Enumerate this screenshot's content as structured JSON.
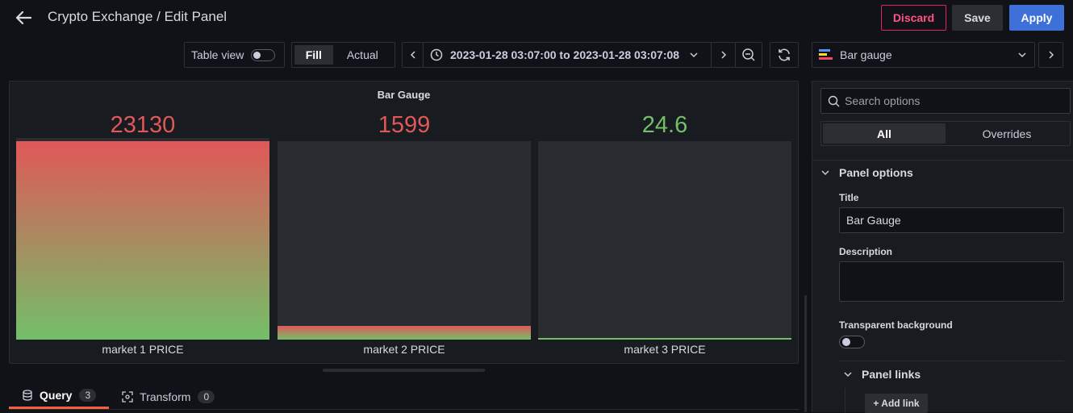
{
  "header": {
    "title": "Crypto Exchange / Edit Panel",
    "discard_label": "Discard",
    "save_label": "Save",
    "apply_label": "Apply"
  },
  "toolbar": {
    "table_view_label": "Table view",
    "fill_label": "Fill",
    "actual_label": "Actual",
    "time_range": "2023-01-28 03:07:00 to 2023-01-28 03:07:08",
    "visualization": "Bar gauge"
  },
  "panel": {
    "title": "Bar Gauge",
    "gauges": [
      {
        "name": "market 1 PRICE",
        "value": "23130",
        "fill_fraction": 1.0,
        "color": "#e05858"
      },
      {
        "name": "market 2 PRICE",
        "value": "1599",
        "fill_fraction": 0.069,
        "color": "#e05858"
      },
      {
        "name": "market 3 PRICE",
        "value": "24.6",
        "fill_fraction": 0.001,
        "color": "#73bf69"
      }
    ]
  },
  "tabs": [
    {
      "label": "Query",
      "count": "3"
    },
    {
      "label": "Transform",
      "count": "0"
    }
  ],
  "options": {
    "search_placeholder": "Search options",
    "all_label": "All",
    "overrides_label": "Overrides",
    "panel_options_label": "Panel options",
    "title_label": "Title",
    "title_value": "Bar Gauge",
    "description_label": "Description",
    "description_value": "",
    "transparent_label": "Transparent background",
    "panel_links_label": "Panel links",
    "add_link_label": "+ Add link"
  },
  "colors": {
    "red": "#e05858",
    "green": "#73bf69",
    "apply_blue": "#3d71d9",
    "discard_pink": "#ff5286"
  }
}
